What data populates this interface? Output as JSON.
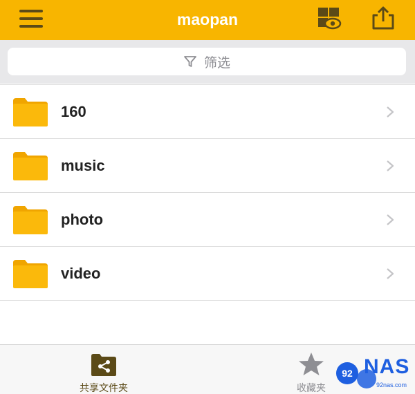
{
  "header": {
    "title": "maopan",
    "menu_icon": "hamburger-menu-icon",
    "view_icon": "grid-eye-icon",
    "share_icon": "share-upload-icon"
  },
  "filter": {
    "placeholder": "筛选",
    "icon": "filter-funnel-icon"
  },
  "folders": [
    {
      "name": "160",
      "icon": "folder-icon"
    },
    {
      "name": "music",
      "icon": "folder-icon"
    },
    {
      "name": "photo",
      "icon": "folder-icon"
    },
    {
      "name": "video",
      "icon": "folder-icon"
    }
  ],
  "tabs": [
    {
      "label": "共享文件夹",
      "icon": "shared-folder-icon",
      "active": true
    },
    {
      "label": "收藏夹",
      "icon": "star-icon",
      "active": false
    }
  ],
  "watermark": {
    "text": "NAS",
    "site": "92nas.com",
    "badge": "92"
  },
  "colors": {
    "accent": "#f8b500",
    "icon_dark": "#5b4a17",
    "folder": "#fbb90b",
    "folder_tab": "#f0a500",
    "separator": "#dcdcdc",
    "watermark": "#1e5fe0"
  }
}
